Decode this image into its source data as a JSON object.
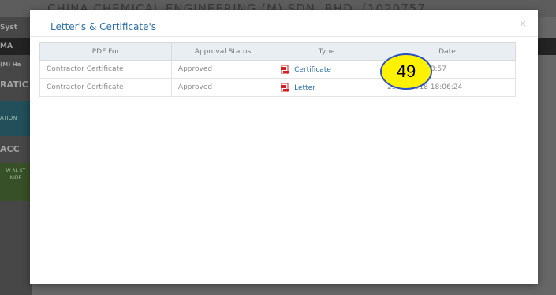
{
  "background": {
    "header_text": "CHINA CHEMICAL ENGINEERING (M) SDN. BHD. (1020757",
    "sidebar": [
      "Syst",
      "MA",
      "(M) He",
      "RATIC",
      "ATION",
      "ACC",
      "W AL ST NIDE"
    ]
  },
  "modal": {
    "title": "Letter's & Certificate's",
    "close_symbol": "×",
    "columns": [
      "PDF For",
      "Approval Status",
      "Type",
      "Date"
    ],
    "rows": [
      {
        "pdf_for": "Contractor Certificate",
        "status": "Approved",
        "type": "Certificate",
        "date": "3/2018 18:18:57"
      },
      {
        "pdf_for": "Contractor Certificate",
        "status": "Approved",
        "type": "Letter",
        "date": "23/03/2018 18:06:24"
      }
    ]
  },
  "annotation": {
    "label": "49",
    "color": "#fff200",
    "border": "#2a4fc6"
  },
  "icons": {
    "pdf": "pdf-file-icon"
  }
}
